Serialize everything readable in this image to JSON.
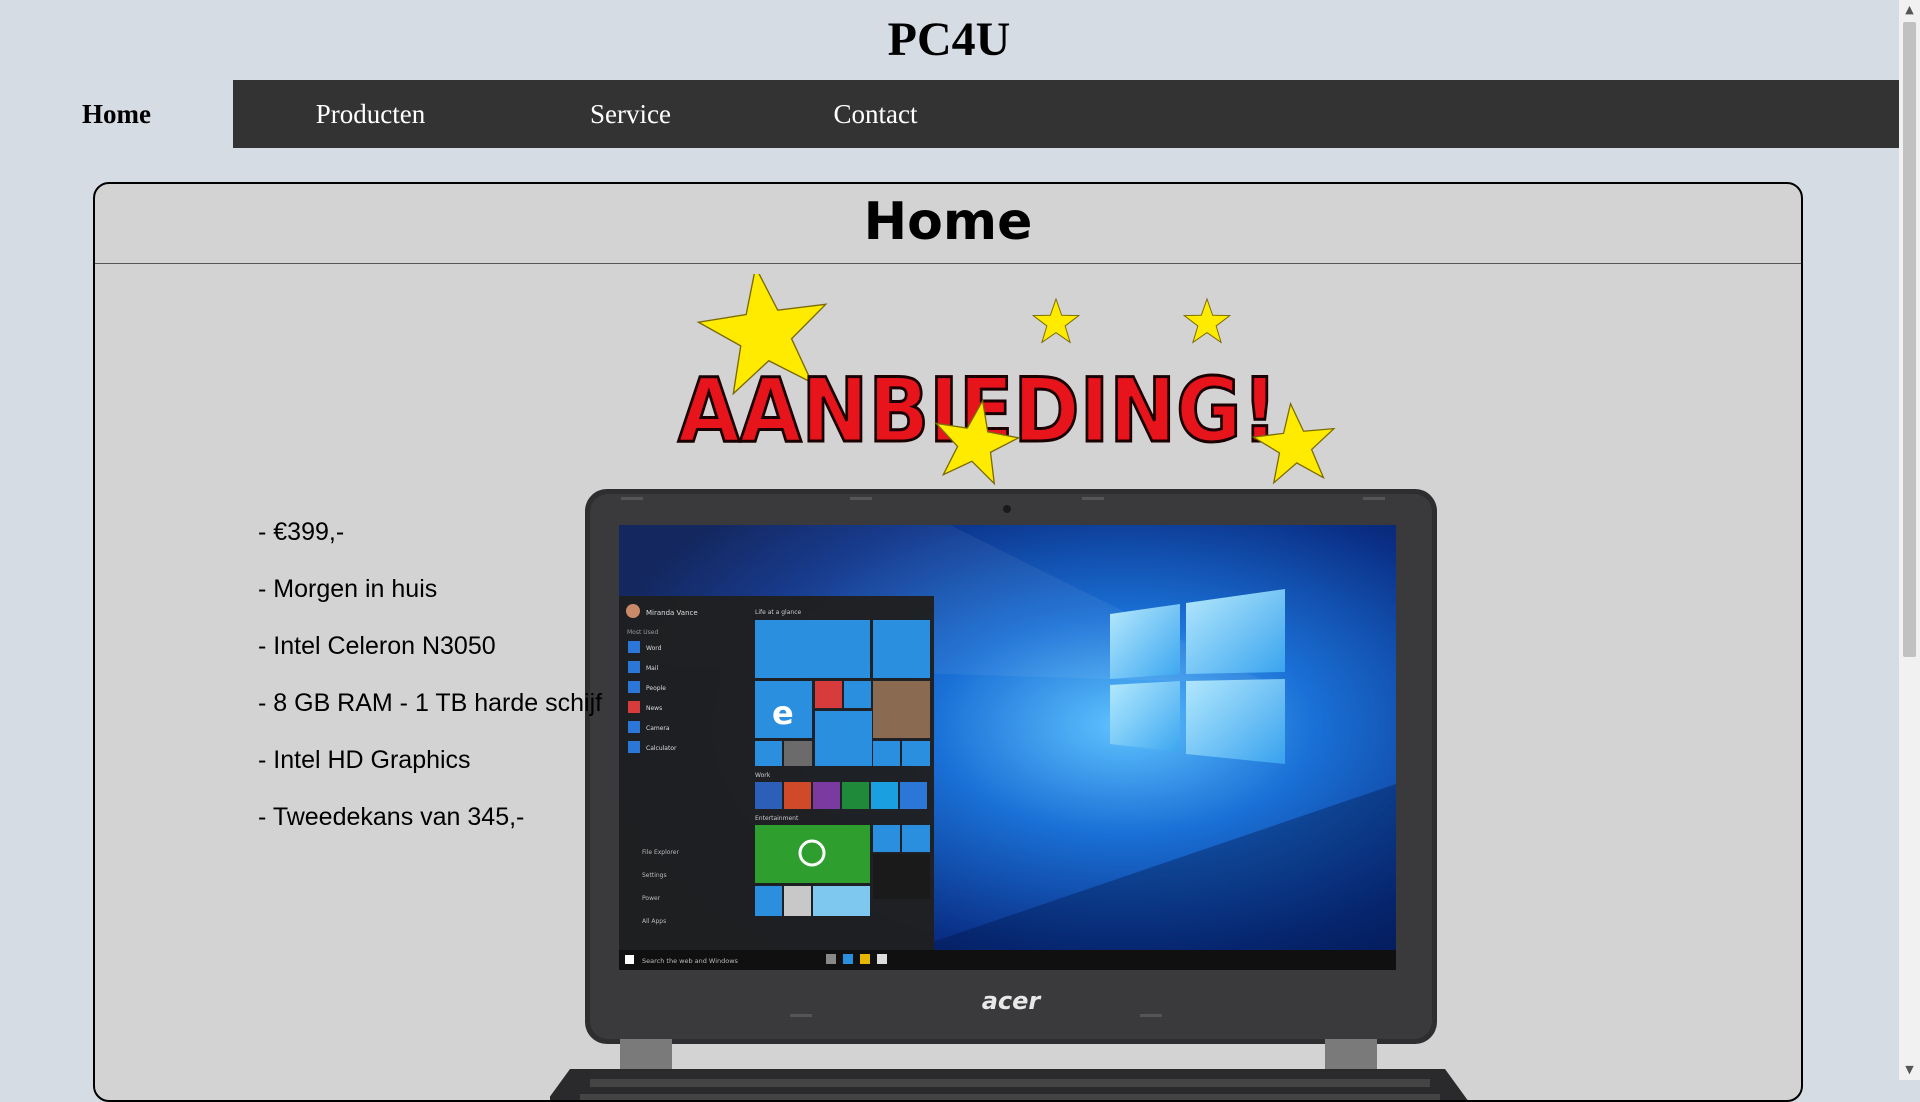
{
  "header": {
    "site_title": "PC4U"
  },
  "nav": {
    "items": [
      {
        "label": "Home",
        "active": true
      },
      {
        "label": "Producten"
      },
      {
        "label": "Service"
      },
      {
        "label": "Contact"
      }
    ]
  },
  "main": {
    "heading": "Home",
    "promo_text": "AANBIEDING!",
    "features": [
      "- €399,-",
      "- Morgen in huis",
      "- Intel Celeron N3050",
      "- 8 GB RAM - 1 TB harde schijf",
      "- Intel HD Graphics",
      "- Tweedekans van 345,-"
    ],
    "laptop_brand": "acer",
    "screen": {
      "user_name": "Miranda Vance",
      "most_used": "Most Used",
      "apps": [
        "Word",
        "Mail",
        "People",
        "News",
        "Camera",
        "Calculator"
      ],
      "life_at_a_glance": "Life at a glance",
      "work": "Work",
      "entertainment": "Entertainment",
      "taskbar_search": "Search the web and Windows",
      "bottom_items": [
        "File Explorer",
        "Settings",
        "Power",
        "All Apps"
      ]
    }
  },
  "colors": {
    "page_bg": "#d6dce4",
    "nav_bg": "#333333",
    "card_bg": "#d3d3d3",
    "promo_red": "#e8141c",
    "star_yellow": "#ffeb00"
  }
}
